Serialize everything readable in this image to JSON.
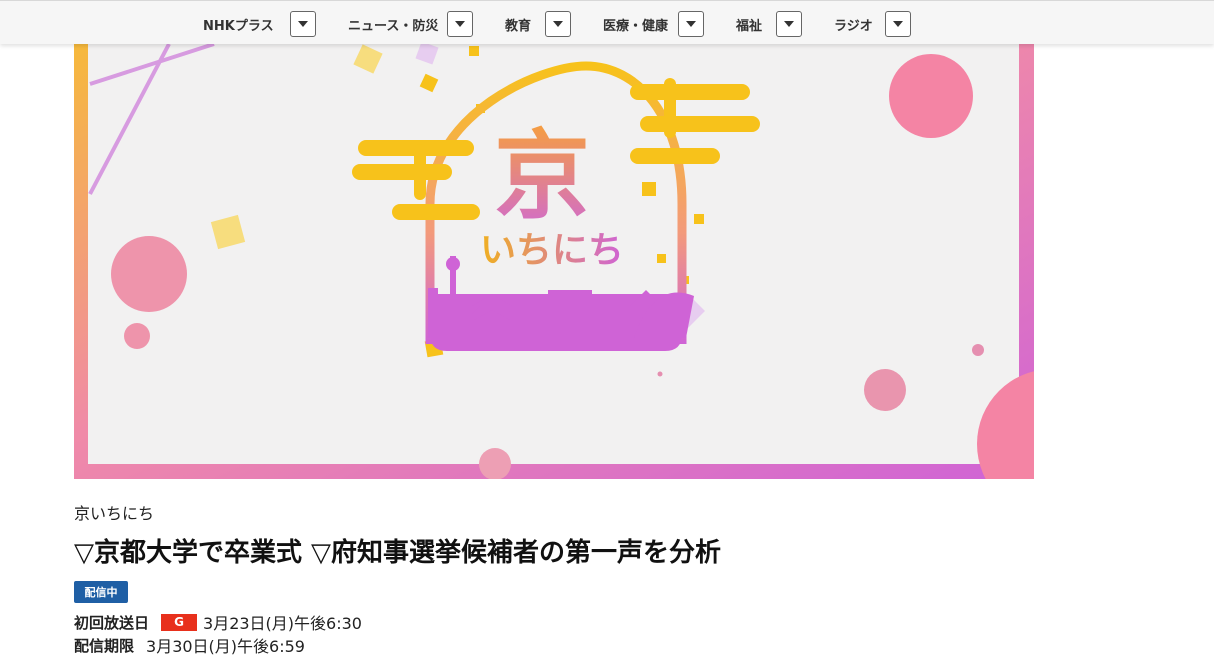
{
  "nav": {
    "items": [
      {
        "label": "NHKプラス"
      },
      {
        "label": "ニュース・防災"
      },
      {
        "label": "教育"
      },
      {
        "label": "医療・健康"
      },
      {
        "label": "福祉"
      },
      {
        "label": "ラジオ"
      }
    ]
  },
  "hero": {
    "logo_kanji": "京",
    "logo_kana": "いちにち"
  },
  "program": {
    "name": "京いちにち",
    "episode_title": "▽京都大学で卒業式 ▽府知事選挙候補者の第一声を分析",
    "status_badge": "配信中",
    "first_broadcast_label": "初回放送日",
    "channel": "G",
    "first_broadcast_value": "3月23日(月)午後6:30",
    "expiry_label": "配信期限",
    "expiry_value": "3月30日(月)午後6:59"
  },
  "colors": {
    "accent_blue": "#1f5fa5",
    "channel_red": "#e8301c",
    "logo_yellow": "#f7c21b",
    "logo_pink": "#f08aa8",
    "logo_purple": "#cf63d6"
  }
}
